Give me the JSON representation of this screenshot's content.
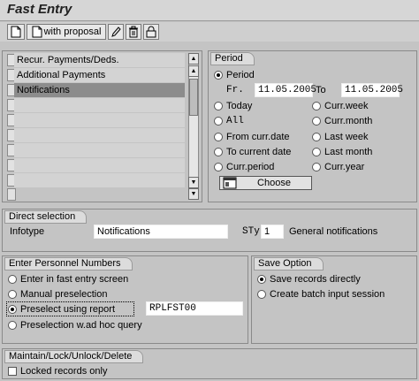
{
  "window": {
    "title": "Fast Entry"
  },
  "toolbar": {
    "with_proposal_label": "with proposal"
  },
  "infotypes_list": {
    "items": [
      "Recur. Payments/Deds.",
      "Additional Payments",
      "Notifications",
      "",
      "",
      "",
      "",
      "",
      ""
    ],
    "selected_index": 2
  },
  "period": {
    "title": "Period",
    "period_label": "Period",
    "from_label": "Fr.",
    "from_value": "11.05.2005",
    "to_label": "To",
    "to_value": "11.05.2005",
    "options_left": [
      "Today",
      "All",
      "From curr.date",
      "To current date",
      "Curr.period"
    ],
    "options_right": [
      "Curr.week",
      "Curr.month",
      "Last week",
      "Last month",
      "Curr.year"
    ],
    "choose_label": "Choose"
  },
  "direct_selection": {
    "title": "Direct selection",
    "infotype_label": "Infotype",
    "infotype_value": "Notifications",
    "sty_label": "STy",
    "sty_value": "1",
    "sty_text": "General notifications"
  },
  "personnel": {
    "title": "Enter Personnel Numbers",
    "options": [
      "Enter in fast entry screen",
      "Manual preselection",
      "Preselect using report",
      "Preselection w.ad hoc query"
    ],
    "selected_index": 2,
    "report_value": "RPLFST00"
  },
  "save_option": {
    "title": "Save Option",
    "options": [
      "Save records directly",
      "Create batch input session"
    ],
    "selected_index": 0
  },
  "maintain": {
    "title": "Maintain/Lock/Unlock/Delete",
    "locked_label": "Locked records only"
  },
  "icons": [
    "new-document-icon",
    "copy-document-icon",
    "pencil-icon",
    "trash-icon",
    "lock-icon",
    "choose-icon"
  ]
}
